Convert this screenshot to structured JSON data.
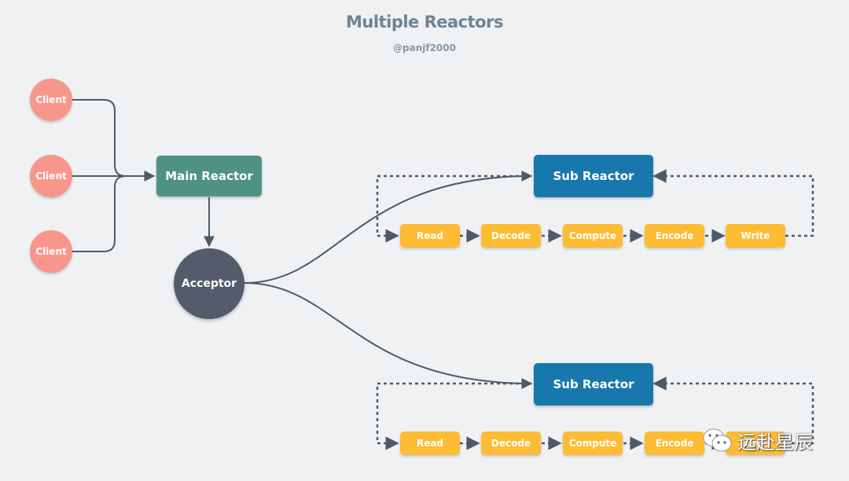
{
  "header": {
    "title": "Multiple Reactors",
    "subtitle": "@panjf2000"
  },
  "clients": [
    {
      "label": "Client"
    },
    {
      "label": "Client"
    },
    {
      "label": "Client"
    }
  ],
  "main_reactor": {
    "label": "Main Reactor"
  },
  "acceptor": {
    "label": "Acceptor"
  },
  "sub_reactors": [
    {
      "label": "Sub Reactor",
      "pipeline": [
        "Read",
        "Decode",
        "Compute",
        "Encode",
        "Write"
      ]
    },
    {
      "label": "Sub Reactor",
      "pipeline": [
        "Read",
        "Decode",
        "Compute",
        "Encode",
        "Write"
      ]
    }
  ],
  "watermark": {
    "text": "远赴星辰",
    "icon": "wechat-icon"
  },
  "colors": {
    "background": "#eff1f3",
    "client": "#f9968b",
    "main_reactor": "#4f9280",
    "acceptor": "#545b6b",
    "sub_reactor": "#1878ad",
    "step": "#fdbc34",
    "connector": "#4d5b69"
  }
}
